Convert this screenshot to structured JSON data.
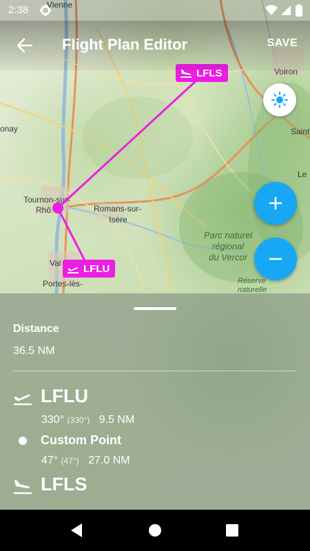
{
  "status_bar": {
    "time": "2:38"
  },
  "app_bar": {
    "title": "Flight Plan Editor",
    "save_label": "SAVE"
  },
  "map": {
    "places": [
      "Vienne",
      "Voiron",
      "Saint",
      "Le",
      "Tournon-sur-",
      "Rhô",
      "Romans-sur-",
      "Isère",
      "Val",
      "Portes-lès-",
      "onay"
    ],
    "park_label": [
      "Parc naturel",
      "régional",
      "du Vercor"
    ],
    "reserve_label": [
      "Réserve",
      "naturelle"
    ],
    "markers": [
      {
        "code": "LFLS"
      },
      {
        "code": "LFLU"
      }
    ],
    "route_color": "#ea1fe3"
  },
  "summary": {
    "distance_label": "Distance",
    "distance_value": "36.5 NM"
  },
  "waypoints": [
    {
      "icon": "departure-plane-icon",
      "name": "LFLU"
    },
    {
      "icon": "point-dot-icon",
      "name": "Custom Point"
    },
    {
      "icon": "arrival-plane-icon",
      "name": "LFLS"
    }
  ],
  "legs": [
    {
      "true_course": "330°",
      "magnetic_course": "(330°)",
      "distance": "9.5 NM"
    },
    {
      "true_course": "47°",
      "magnetic_course": "(47°)",
      "distance": "27.0 NM"
    }
  ],
  "colors": {
    "accent": "#18a7f5",
    "route": "#ea1fe3"
  }
}
